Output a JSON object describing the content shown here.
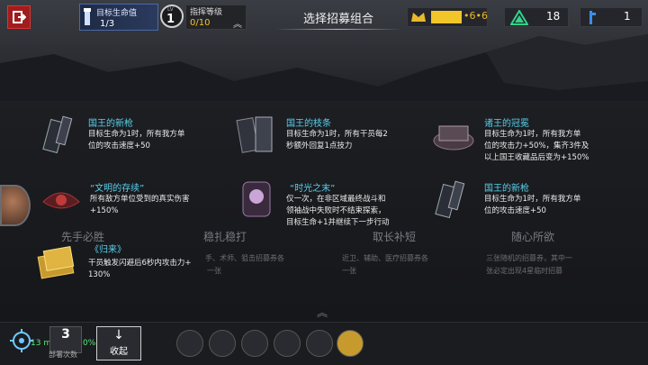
{
  "header": {
    "hp_label": "目标生命值",
    "hp_value": "1/3",
    "level_label": "LV",
    "level_value": "1",
    "rank_label": "指挥等级",
    "rank_value": "0/10",
    "title": "选择招募组合",
    "gold_value": "6",
    "gold_value2": "6",
    "green_value": "18",
    "blue_value": "1"
  },
  "items": [
    {
      "title": "国王的新枪",
      "desc": [
        "目标生命为1时，所有我方单",
        "位的攻击速度+50"
      ]
    },
    {
      "title": "国王的枝条",
      "desc": [
        "目标生命为1时，所有干员每2",
        "秒额外回复1点技力"
      ]
    },
    {
      "title": "诸王的冠冕",
      "desc": [
        "目标生命为1时，所有我方单",
        "位的攻击力+50%，集齐3件及",
        "以上国王收藏品后变为+150%"
      ]
    },
    {
      "title": "“文明的存续”",
      "desc": [
        "所有敌方单位受到的真实伤害",
        "+150%"
      ]
    },
    {
      "title": "“时光之末”",
      "desc": [
        "仅一次，在非区域最终战斗和",
        "领袖战中失败时不结束探索，",
        "目标生命+1并继续下一步行动"
      ]
    },
    {
      "title": "国王的新枪",
      "desc": [
        "目标生命为1时，所有我方单",
        "位的攻击速度+50"
      ]
    },
    {
      "title": "《归来》",
      "desc": [
        "干员触发闪避后6秒内攻击力+",
        "130%"
      ]
    }
  ],
  "columns": [
    {
      "title": "先手必胜",
      "desc": ""
    },
    {
      "title": "稳扎稳打",
      "desc": "手、术师、狙击招募券各"
    },
    {
      "title": "取长补短",
      "desc": "近卫、辅助、医疗招募券各"
    },
    {
      "title": "随心所欲",
      "desc": "三张随机的招募券，其中一"
    }
  ],
  "col_desc2": [
    "一张",
    "一张",
    "张必定出现4星临时招募"
  ],
  "bottom": {
    "ping": "13 ms",
    "pct": "0%",
    "deploy_count": "3",
    "deploy_label": "部署次数",
    "collapse_label": "收起"
  }
}
